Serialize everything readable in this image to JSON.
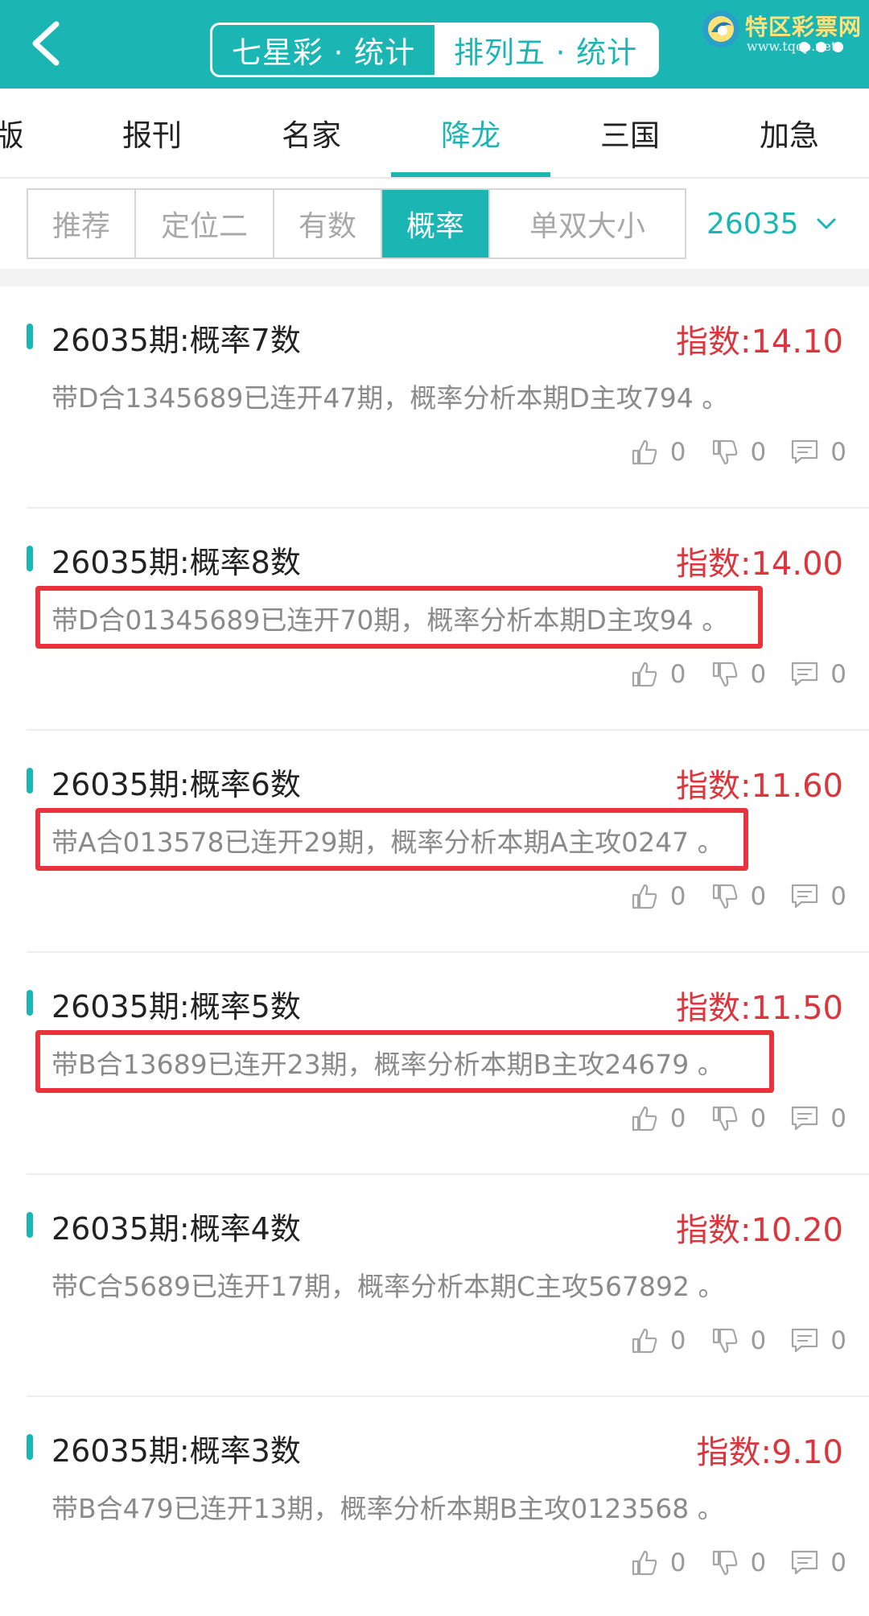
{
  "header": {
    "back_icon": "chevron-left-icon",
    "segments": [
      "七星彩 · 统计",
      "排列五 · 统计"
    ],
    "active_segment": 1,
    "brand_name": "特区彩票网",
    "brand_url": "www.tqcp.net",
    "more_icon": "more-dots-icon"
  },
  "categories": {
    "items": [
      "版",
      "报刊",
      "名家",
      "降龙",
      "三国",
      "加急"
    ],
    "active": 3
  },
  "filters": {
    "items": [
      "推荐",
      "定位二",
      "有数",
      "概率",
      "单双大小"
    ],
    "active": 3,
    "issue": "26035"
  },
  "cards": [
    {
      "title": "26035期:概率7数",
      "index": "指数:14.10",
      "desc": "带D合1345689已连开47期，概率分析本期D主攻794 。",
      "likes": "0",
      "dislikes": "0",
      "comments": "0"
    },
    {
      "title": "26035期:概率8数",
      "index": "指数:14.00",
      "desc": "带D合01345689已连开70期，概率分析本期D主攻94 。",
      "likes": "0",
      "dislikes": "0",
      "comments": "0"
    },
    {
      "title": "26035期:概率6数",
      "index": "指数:11.60",
      "desc": "带A合013578已连开29期，概率分析本期A主攻0247 。",
      "likes": "0",
      "dislikes": "0",
      "comments": "0"
    },
    {
      "title": "26035期:概率5数",
      "index": "指数:11.50",
      "desc": "带B合13689已连开23期，概率分析本期B主攻24679 。",
      "likes": "0",
      "dislikes": "0",
      "comments": "0"
    },
    {
      "title": "26035期:概率4数",
      "index": "指数:10.20",
      "desc": "带C合5689已连开17期，概率分析本期C主攻567892 。",
      "likes": "0",
      "dislikes": "0",
      "comments": "0"
    },
    {
      "title": "26035期:概率3数",
      "index": "指数:9.10",
      "desc": "带B合479已连开13期，概率分析本期B主攻0123568 。",
      "likes": "0",
      "dislikes": "0",
      "comments": "0"
    }
  ],
  "colors": {
    "accent": "#1bb6b4",
    "index_red": "#d9363e",
    "highlight_box": "#e8323c"
  }
}
